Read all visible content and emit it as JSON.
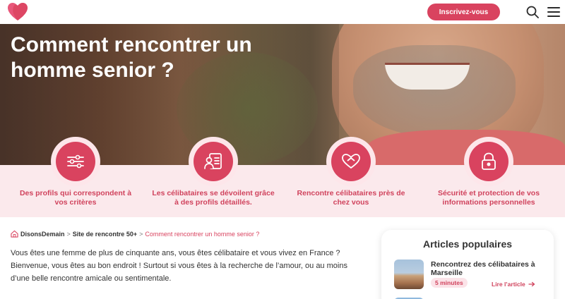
{
  "header": {
    "cta_label": "Inscrivez-vous",
    "icons": [
      "heart-logo-icon",
      "search-icon",
      "menu-icon"
    ],
    "brand_color": "#d9435f"
  },
  "hero": {
    "title_line1": "Comment rencontrer un",
    "title_line2": "homme senior ?"
  },
  "features": [
    {
      "icon": "sliders-icon",
      "label_line1": "Des profils qui correspondent à",
      "label_line2": "vos critères"
    },
    {
      "icon": "profile-card-icon",
      "label_line1": "Les célibataires se dévoilent grâce",
      "label_line2": "à des profils détaillés."
    },
    {
      "icon": "hearts-icon",
      "label_line1": "Rencontre célibataires près de",
      "label_line2": "chez vous"
    },
    {
      "icon": "lock-icon",
      "label_line1": "Sécurité et protection de vos",
      "label_line2": "informations personnelles"
    }
  ],
  "breadcrumb": {
    "home": "DisonsDemain",
    "level2": "Site de rencontre 50+",
    "current": "Comment rencontrer un homme senior ?",
    "separator": ">"
  },
  "content": {
    "paragraph1": "Vous êtes une femme de plus de cinquante ans, vous êtes célibataire et vous vivez en France ? Bienvenue, vous êtes au bon endroit ! Surtout si vous êtes à la recherche de l’amour, ou au moins d’une belle rencontre amicale ou sentimentale."
  },
  "sidebar": {
    "title": "Articles populaires",
    "articles": [
      {
        "title": "Rencontrez des célibataires à Marseille",
        "time": "5 minutes",
        "read_label": "Lire l’article"
      }
    ]
  }
}
